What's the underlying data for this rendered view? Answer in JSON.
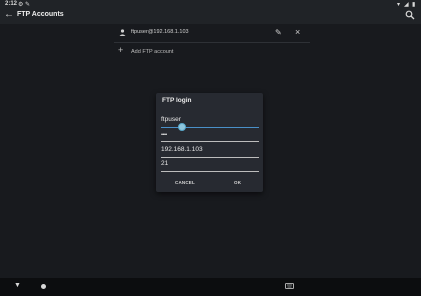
{
  "status_bar": {
    "time": "2:12",
    "icons": [
      "settings-icon",
      "notification-icon",
      "wifi-icon",
      "signal-icon",
      "battery-icon"
    ]
  },
  "app_bar": {
    "title": "FTP Accounts",
    "back_icon": "arrow-back-icon",
    "search_icon": "search-icon"
  },
  "accounts": [
    {
      "label": "ftpuser@192.168.1.103"
    }
  ],
  "add_account": {
    "label": "Add FTP account"
  },
  "dialog": {
    "title": "FTP login",
    "username": "ftpuser",
    "password_mask": "••••",
    "host": "192.168.1.103",
    "port": "21",
    "cancel_label": "CANCEL",
    "ok_label": "OK"
  },
  "colors": {
    "background": "#181a1e",
    "bars": "#202327",
    "dialog": "#272a31",
    "accent": "#4a90c8"
  }
}
